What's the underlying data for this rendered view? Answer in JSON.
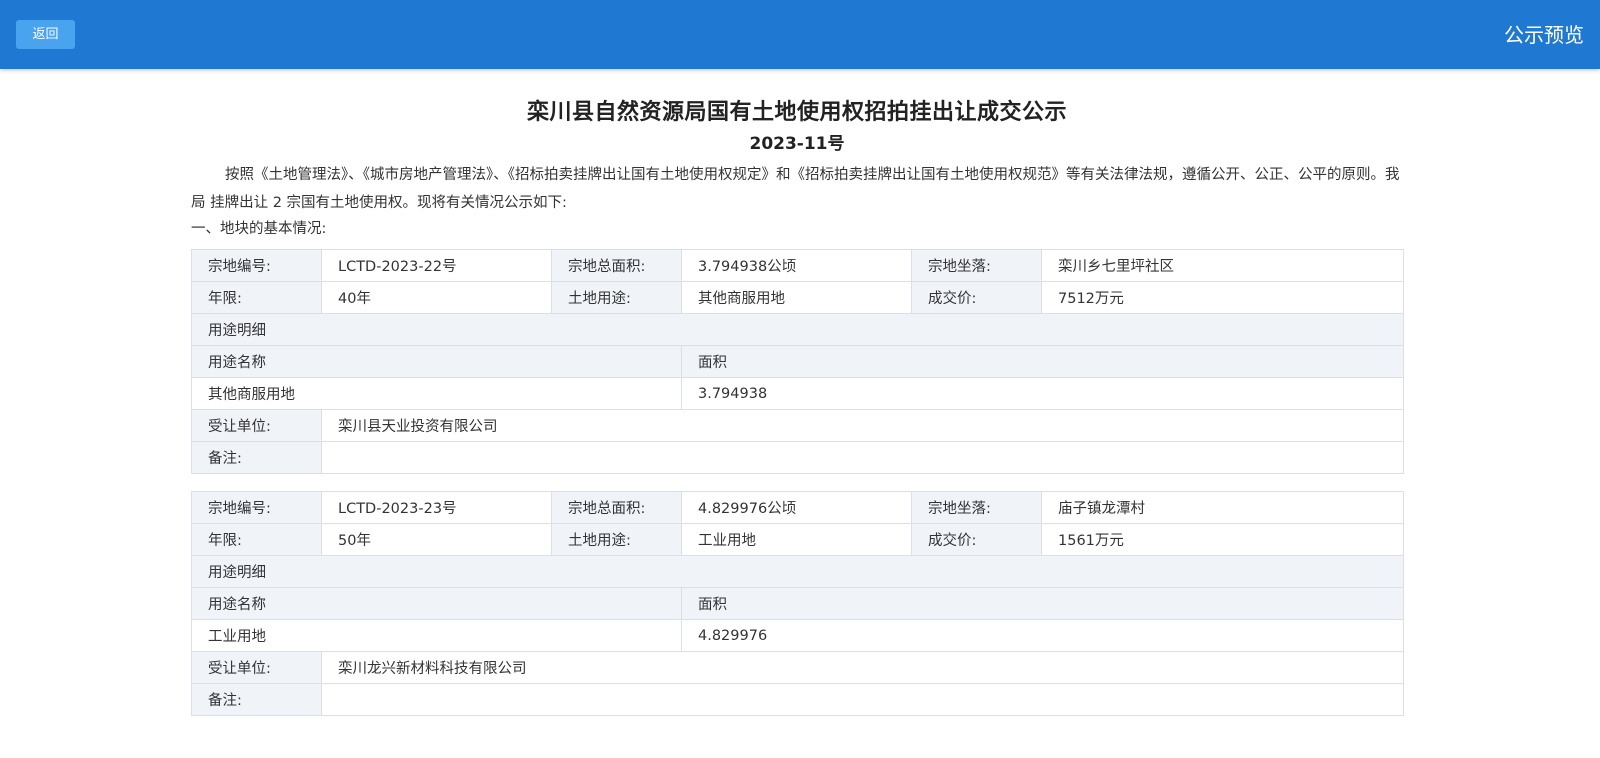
{
  "header": {
    "back_label": "返回",
    "title": "公示预览"
  },
  "doc": {
    "title": "栾川县自然资源局国有土地使用权招拍挂出让成交公示",
    "number": "2023-11号",
    "intro": "按照《土地管理法》、《城市房地产管理法》、《招标拍卖挂牌出让国有土地使用权规定》和《招标拍卖挂牌出让国有土地使用权规范》等有关法律法规，遵循公开、公正、公平的原则。我局 挂牌出让 2 宗国有土地使用权。现将有关情况公示如下:",
    "section_heading": "一、地块的基本情况:"
  },
  "labels": {
    "parcel_no": "宗地编号:",
    "total_area": "宗地总面积:",
    "location": "宗地坐落:",
    "term": "年限:",
    "land_use": "土地用途:",
    "price": "成交价:",
    "use_detail": "用途明细",
    "use_name": "用途名称",
    "area": "面积",
    "grantee": "受让单位:",
    "remark": "备注:"
  },
  "parcels": [
    {
      "parcel_no": "LCTD-2023-22号",
      "total_area": "3.794938公顷",
      "location": "栾川乡七里坪社区",
      "term": "40年",
      "land_use": "其他商服用地",
      "price": "7512万元",
      "use_name": "其他商服用地",
      "use_area": "3.794938",
      "grantee": "栾川县天业投资有限公司",
      "remark": ""
    },
    {
      "parcel_no": "LCTD-2023-23号",
      "total_area": "4.829976公顷",
      "location": "庙子镇龙潭村",
      "term": "50年",
      "land_use": "工业用地",
      "price": "1561万元",
      "use_name": "工业用地",
      "use_area": "4.829976",
      "grantee": "栾川龙兴新材料科技有限公司",
      "remark": ""
    }
  ],
  "colors": {
    "header_bg": "#1f78d1",
    "back_button_bg": "#4aa3ee",
    "label_cell_bg": "#f0f4f9",
    "border": "#dcdfe6"
  }
}
